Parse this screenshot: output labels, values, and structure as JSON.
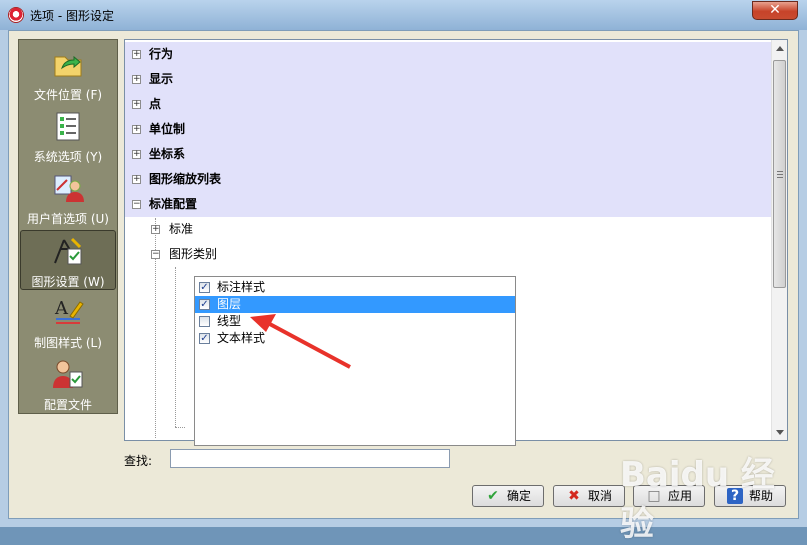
{
  "window": {
    "title": "选项 - 图形设定",
    "close_glyph": "✕"
  },
  "sidebar": {
    "items": [
      {
        "label": "文件位置 (F)",
        "icon": "folder-arrow-icon"
      },
      {
        "label": "系统选项 (Y)",
        "icon": "checklist-icon"
      },
      {
        "label": "用户首选项 (U)",
        "icon": "user-tools-icon"
      },
      {
        "label": "图形设置 (W)",
        "icon": "drawing-settings-icon",
        "selected": true
      },
      {
        "label": "制图样式 (L)",
        "icon": "text-style-icon"
      },
      {
        "label": "配置文件",
        "icon": "user-profile-icon"
      }
    ]
  },
  "tree": {
    "nodes": [
      {
        "label": "行为",
        "expander": "+"
      },
      {
        "label": "显示",
        "expander": "+"
      },
      {
        "label": "点",
        "expander": "+"
      },
      {
        "label": "单位制",
        "expander": "+"
      },
      {
        "label": "坐标系",
        "expander": "+"
      },
      {
        "label": "图形缩放列表",
        "expander": "+"
      },
      {
        "label": "标准配置",
        "expander": "−"
      }
    ],
    "children": [
      {
        "label": "标准",
        "expander": "+"
      },
      {
        "label": "图形类别",
        "expander": "−"
      }
    ],
    "checklist": [
      {
        "label": "标注样式",
        "checked": true,
        "selected": false
      },
      {
        "label": "图层",
        "checked": true,
        "selected": true
      },
      {
        "label": "线型",
        "checked": false,
        "selected": false
      },
      {
        "label": "文本样式",
        "checked": true,
        "selected": false
      }
    ]
  },
  "search": {
    "label": "查找:",
    "value": ""
  },
  "buttons": {
    "ok": {
      "label": "确定",
      "icon": "green-check-icon"
    },
    "cancel": {
      "label": "取消",
      "icon": "red-x-icon"
    },
    "apply": {
      "label": "应用",
      "icon": "apply-icon"
    },
    "help": {
      "label": "帮助",
      "icon": "help-icon"
    }
  },
  "watermark": {
    "text": "Baidu 经验"
  },
  "colors": {
    "selection": "#3399ff",
    "tree_top_bg": "#e1e1fa",
    "sidebar_bg": "#8c8c72"
  }
}
